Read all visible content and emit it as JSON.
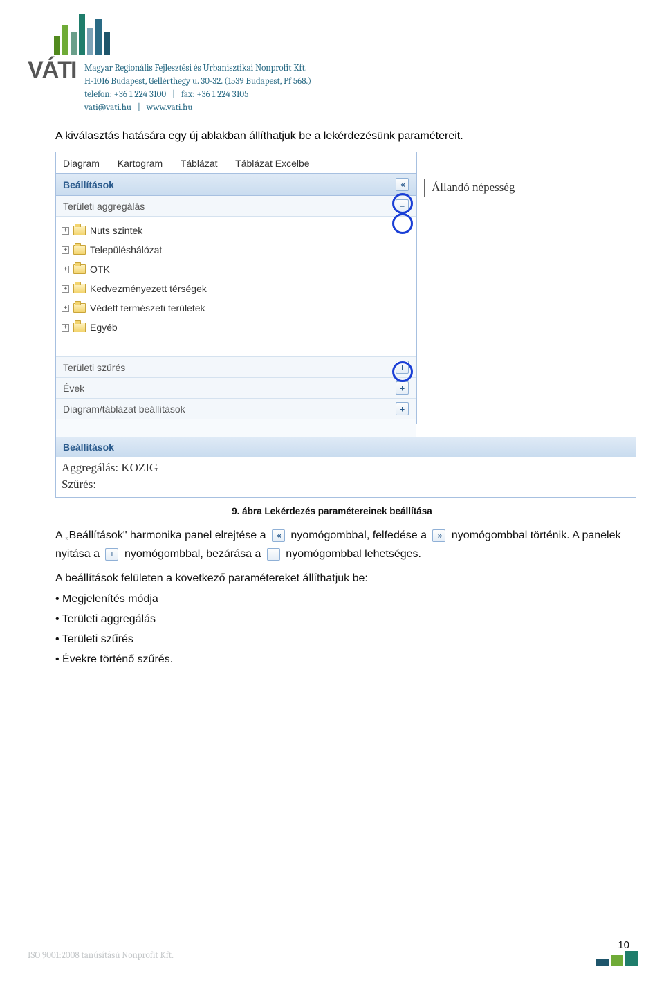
{
  "header": {
    "vati": "VÁTI",
    "company": "Magyar Regionális Fejlesztési és Urbanisztikai Nonprofit Kft.",
    "address": "H-1016 Budapest, Gellérthegy u. 30-32. (1539 Budapest, Pf 568.)",
    "phone": "telefon: +36 1 224 3100",
    "phone_sep": "|",
    "fax_label": "fax: +36 1 224 3105",
    "email": "vati@vati.hu",
    "link_sep": "|",
    "site": "www.vati.hu"
  },
  "intro": "A kiválasztás hatására egy új ablakban állíthatjuk be a lekérdezésünk paramétereit.",
  "shot": {
    "tabs": [
      "Diagram",
      "Kartogram",
      "Táblázat",
      "Táblázat Excelbe"
    ],
    "section_settings": "Beállítások",
    "sub_area_agg": "Területi aggregálás",
    "tree": [
      "Nuts szintek",
      "Településhálózat",
      "OTK",
      "Kedvezményezett térségek",
      "Védett természeti területek",
      "Egyéb"
    ],
    "sub_area_filter": "Területi szűrés",
    "sub_years": "Évek",
    "sub_chart": "Diagram/táblázat beállítások",
    "footer_settings": "Beállítások",
    "agg_line": "Aggregálás: KOZIG",
    "filter_line": "Szűrés:",
    "right_tag": "Állandó népesség",
    "btn_chev_left": "«",
    "btn_chev_right": "»",
    "btn_plus": "+",
    "btn_minus": "−"
  },
  "caption": "9. ábra Lekérdezés paramétereinek beállítása",
  "para1_a": "A „Beállítások\" harmonika panel elrejtése a ",
  "para1_b": " nyomógombbal, felfedése a ",
  "para1_c": " nyomógombbal történik. A panelek nyitása a ",
  "para1_d": " nyomógombbal, bezárása a ",
  "para1_e": " nyomógombbal lehetséges.",
  "para2": "A beállítások felületen a következő paramétereket állíthatjuk be:",
  "bullets": [
    "Megjelenítés módja",
    "Területi aggregálás",
    "Területi szűrés",
    "Évekre történő szűrés."
  ],
  "iso": "ISO 9001:2008 tanúsítású Nonprofit Kft.",
  "page_num": "10"
}
